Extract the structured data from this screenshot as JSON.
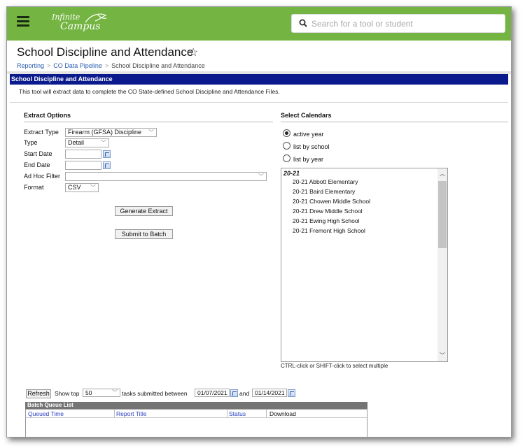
{
  "header": {
    "menu_icon": "hamburger-icon",
    "logo_top": "Infinite",
    "logo_bottom": "Campus",
    "search_placeholder": "Search for a tool or student",
    "search_icon": "search-icon",
    "accent_color": "#74b442"
  },
  "page": {
    "title": "School Discipline and Attendance",
    "favorite_icon": "star-outline-icon",
    "breadcrumb": [
      "Reporting",
      "CO Data Pipeline",
      "School Discipline and Attendance"
    ]
  },
  "panel": {
    "title": "School Discipline and Attendance",
    "description": "This tool will extract data to complete the CO State-defined School Discipline and Attendance Files."
  },
  "extract_options": {
    "heading": "Extract Options",
    "extract_type_label": "Extract Type",
    "extract_type_value": "Firearm (GFSA) Discipline",
    "type_label": "Type",
    "type_value": "Detail",
    "start_date_label": "Start Date",
    "start_date_value": "",
    "end_date_label": "End Date",
    "end_date_value": "",
    "ad_hoc_label": "Ad Hoc Filter",
    "ad_hoc_value": "",
    "format_label": "Format",
    "format_value": "CSV",
    "generate_button": "Generate Extract",
    "submit_button": "Submit to Batch"
  },
  "calendars": {
    "heading": "Select Calendars",
    "options": [
      "active year",
      "list by school",
      "list by year"
    ],
    "selected_option": "active year",
    "group": "20-21",
    "items": [
      "20-21 Abbott Elementary",
      "20-21 Baird Elementary",
      "20-21 Chowen Middle School",
      "20-21 Drew Middle School",
      "20-21 Ewing High School",
      "20-21 Fremont High School"
    ],
    "hint": "CTRL-click or SHIFT-click to select multiple"
  },
  "batch": {
    "refresh_button": "Refresh",
    "show_top_label": "Show top",
    "show_top_value": "50",
    "tasks_label": "tasks submitted between",
    "from_date": "01/07/2021",
    "and_label": "and",
    "to_date": "01/14/2021",
    "list_title": "Batch Queue List",
    "columns": [
      "Queued Time",
      "Report Title",
      "Status",
      "Download"
    ]
  }
}
